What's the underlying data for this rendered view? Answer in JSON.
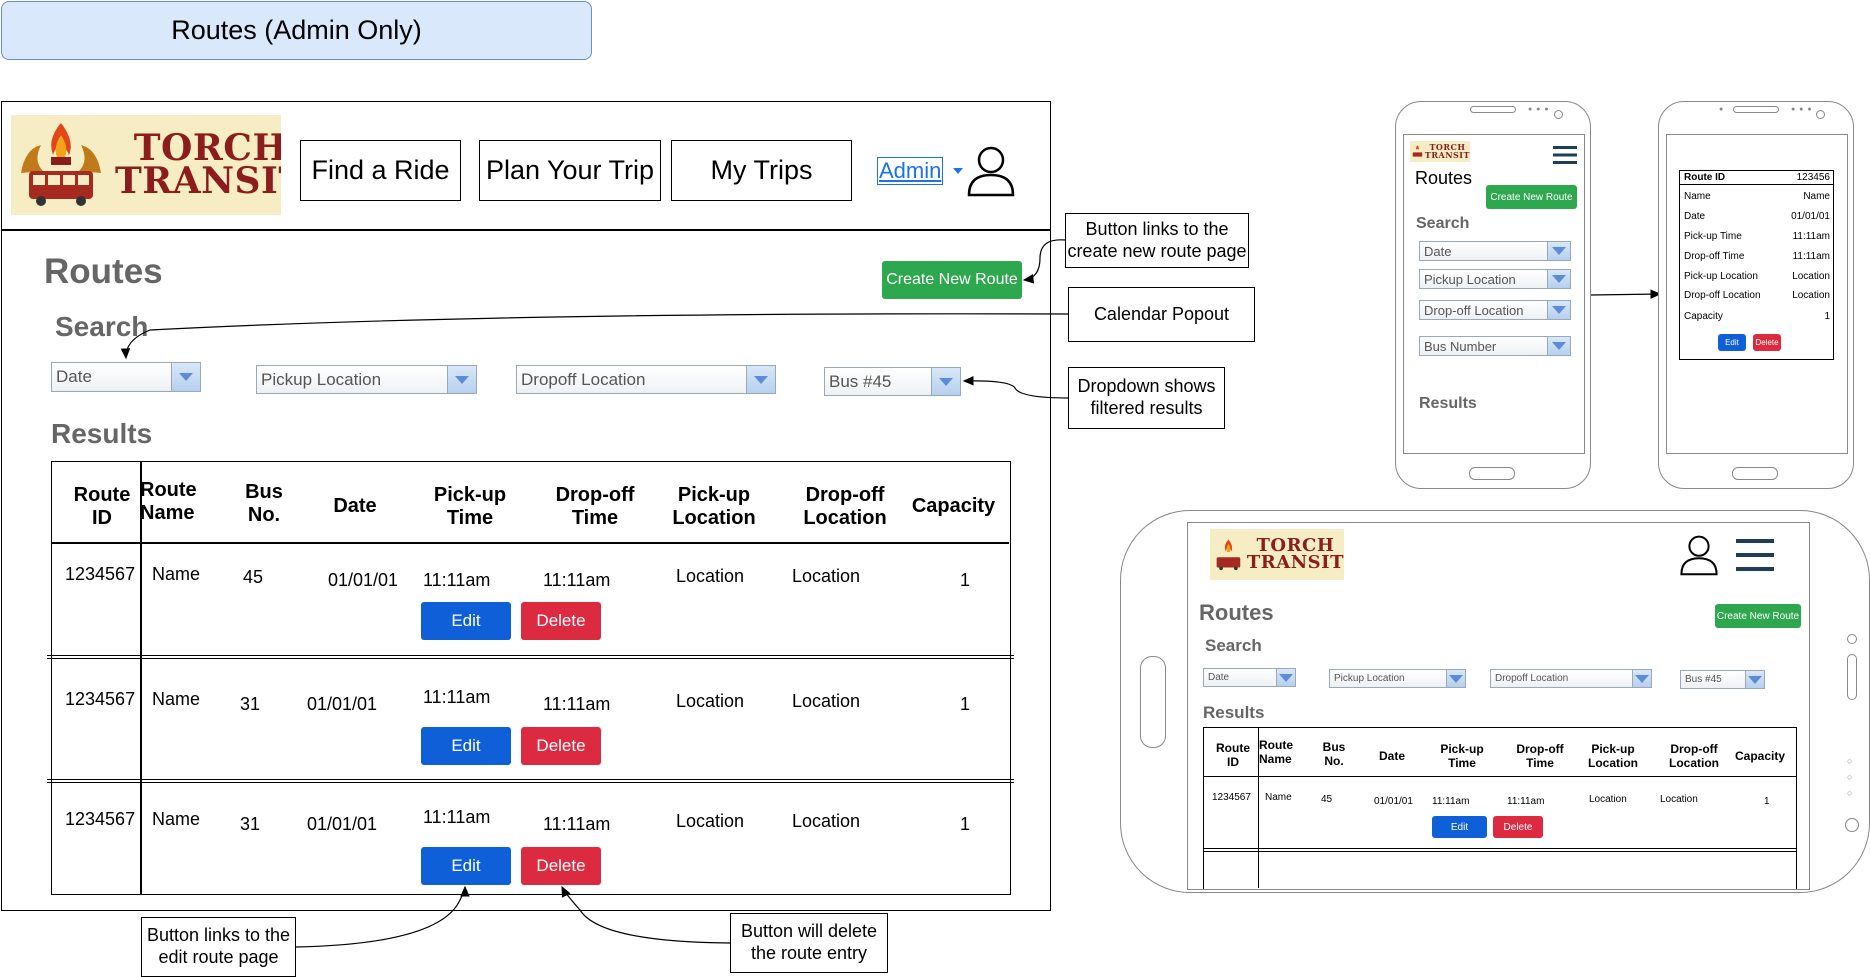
{
  "banner": {
    "title": "Routes (Admin Only)"
  },
  "brand": {
    "line1": "TORCH",
    "line2": "TRANSIT"
  },
  "nav": {
    "find_ride": "Find a Ride",
    "plan_trip": "Plan Your Trip",
    "my_trips": "My Trips",
    "admin": "Admin"
  },
  "page": {
    "title": "Routes",
    "create_btn": "Create New Route",
    "search_heading": "Search",
    "results_heading": "Results"
  },
  "filters": {
    "date": "Date",
    "pickup": "Pickup Location",
    "dropoff": "Dropoff Location",
    "bus": "Bus #45"
  },
  "table": {
    "headers": [
      {
        "l1": "Route",
        "l2": "ID"
      },
      {
        "l1": "Route",
        "l2": "Name"
      },
      {
        "l1": "Bus",
        "l2": "No."
      },
      {
        "l1": "Date",
        "l2": ""
      },
      {
        "l1": "Pick-up",
        "l2": "Time"
      },
      {
        "l1": "Drop-off",
        "l2": "Time"
      },
      {
        "l1": "Pick-up",
        "l2": "Location"
      },
      {
        "l1": "Drop-off",
        "l2": "Location"
      },
      {
        "l1": "Capacity",
        "l2": ""
      }
    ],
    "rows": [
      {
        "id": "1234567",
        "name": "Name",
        "bus": "45",
        "date": "01/01/01",
        "pickup_time": "11:11am",
        "dropoff_time": "11:11am",
        "pickup_loc": "Location",
        "dropoff_loc": "Location",
        "capacity": "1"
      },
      {
        "id": "1234567",
        "name": "Name",
        "bus": "31",
        "date": "01/01/01",
        "pickup_time": "11:11am",
        "dropoff_time": "11:11am",
        "pickup_loc": "Location",
        "dropoff_loc": "Location",
        "capacity": "1"
      },
      {
        "id": "1234567",
        "name": "Name",
        "bus": "31",
        "date": "01/01/01",
        "pickup_time": "11:11am",
        "dropoff_time": "11:11am",
        "pickup_loc": "Location",
        "dropoff_loc": "Location",
        "capacity": "1"
      }
    ],
    "edit": "Edit",
    "delete": "Delete"
  },
  "notes": {
    "create": "Button links to the\ncreate new route page",
    "calendar": "Calendar Popout",
    "dropdown": "Dropdown shows\nfiltered results",
    "edit": "Button links to the\nedit route page",
    "delete": "Button will delete\nthe route entry"
  },
  "mobile": {
    "title": "Routes",
    "create_btn": "Create New Route",
    "search": "Search",
    "filters": [
      "Date",
      "Pickup Location",
      "Drop-off Location",
      "Bus Number"
    ],
    "results": "Results"
  },
  "detail": {
    "rows": [
      {
        "k": "Route ID",
        "v": "123456"
      },
      {
        "k": "Name",
        "v": "Name"
      },
      {
        "k": "Date",
        "v": "01/01/01"
      },
      {
        "k": "Pick-up Time",
        "v": "11:11am"
      },
      {
        "k": "Drop-off Time",
        "v": "11:11am"
      },
      {
        "k": "Pick-up Location",
        "v": "Location"
      },
      {
        "k": "Drop-off Location",
        "v": "Location"
      },
      {
        "k": "Capacity",
        "v": "1"
      }
    ],
    "edit": "Edit",
    "delete": "Delete"
  },
  "tablet": {
    "title": "Routes",
    "create_btn": "Create New Route",
    "search": "Search",
    "results": "Results",
    "filters": [
      "Date",
      "Pickup Location",
      "Dropoff Location",
      "Bus #45"
    ],
    "row": {
      "id": "1234567",
      "name": "Name",
      "bus": "45",
      "date": "01/01/01",
      "pickup_time": "11:11am",
      "dropoff_time": "11:11am",
      "pickup_loc": "Location",
      "dropoff_loc": "Location",
      "capacity": "1"
    },
    "edit": "Edit",
    "delete": "Delete"
  },
  "colors": {
    "green": "#2ea84f",
    "blue": "#0e5fd8",
    "red": "#dc2a40",
    "banner": "#dae8fc",
    "heading_gray": "#666666"
  }
}
